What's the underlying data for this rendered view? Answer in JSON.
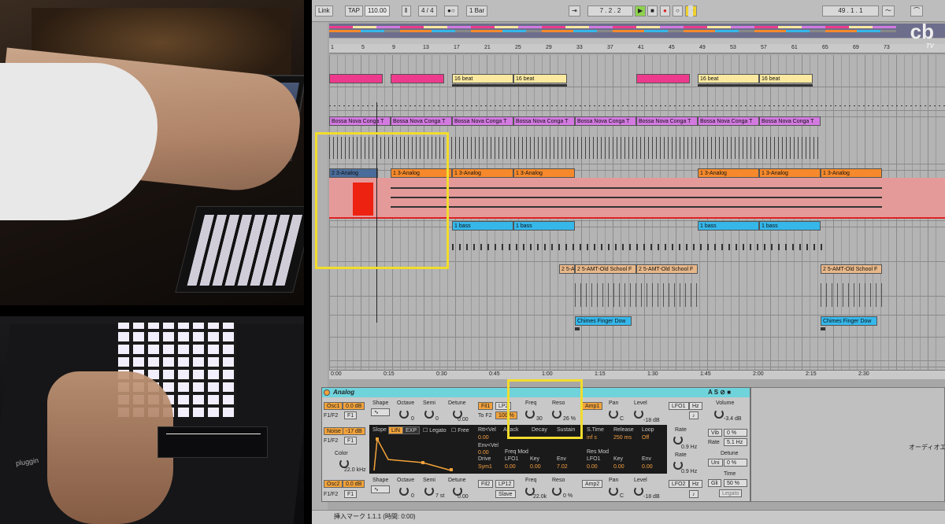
{
  "control_bar": {
    "link": "Link",
    "tap": "TAP",
    "tempo": "110.00",
    "signature": "4 / 4",
    "quantize": "1 Bar",
    "position": "7 . 2 . 2",
    "loop_position": "49 . 1 . 1"
  },
  "ruler": [
    "1",
    "5",
    "9",
    "13",
    "17",
    "21",
    "25",
    "29",
    "33",
    "37",
    "41",
    "45",
    "49",
    "53",
    "57",
    "61",
    "65",
    "69",
    "73"
  ],
  "timebar": [
    "0:00",
    "0:15",
    "0:30",
    "0:45",
    "1:00",
    "1:15",
    "1:30",
    "1:45",
    "2:00",
    "2:15",
    "2:30"
  ],
  "clips": {
    "beat1": "16 beat",
    "beat2": "16 beat",
    "beat3": "16 beat",
    "beat4": "16 beat",
    "bossa": "Bossa Nova Conga T",
    "analog_sel": "2 3-Analog",
    "analog": "1 3-Analog",
    "bass": "1 bass",
    "amt_short": "2 5-A",
    "amt": "2 5-AMT-Old School F",
    "chimes": "Chimes Finger Dow"
  },
  "device": {
    "title": "Analog",
    "osc1": "Osc1",
    "osc1_level": "0.0 dB",
    "f1f2": "F1/F2",
    "f1": "F1",
    "noise": "Noise",
    "noise_level": "-17 dB",
    "color_label": "Color",
    "color_value": "22.0 kHz",
    "osc2": "Osc2",
    "osc2_level": "0.0 dB",
    "shape": "Shape",
    "octave": "Octave",
    "semi": "Semi",
    "detune": "Detune",
    "octave_val": "0",
    "semi_val": "0",
    "detune_val": "0.00",
    "osc2_semi_val": "7 st",
    "fil1": "Fil1",
    "fil1_type": "LP2",
    "to_f2": "To F2",
    "to_f2_val": "100 %",
    "freq": "Freq",
    "freq_val": "30",
    "reso": "Reso",
    "reso_val": "26 %",
    "amp1": "Amp1",
    "pan": "Pan",
    "pan_val": "C",
    "level": "Level",
    "level_val": "-18 dB",
    "lfo1": "LFO1",
    "hz": "Hz",
    "rate": "Rate",
    "rate_val": "0.9 Hz",
    "volume": "Volume",
    "volume_val": "-3.4 dB",
    "vib": "Vib",
    "vib_val": "0 %",
    "rate2_val": "5.1 Hz",
    "unison": "Uni",
    "unison_val": "0 %",
    "detune_global": "Detune",
    "time": "Time",
    "gli": "Gli",
    "gli_val": "50 %",
    "legato": "Legato",
    "fil2": "Fil2",
    "fil2_type": "LP12",
    "slave": "Slave",
    "fil2_freq_val": "22.0k",
    "fil2_reso_val": "0 %",
    "amp2": "Amp2",
    "amp2_pan": "C",
    "amp2_level": "-18 dB",
    "lfo2": "LFO2"
  },
  "envelope": {
    "slope": "Slope",
    "lin": "LIN",
    "exp": "EXP",
    "legato": "Legato",
    "free": "Free",
    "attack": "Attack",
    "decay": "Decay",
    "sustain": "Sustain",
    "stime": "S.Time",
    "release": "Release",
    "loop": "Loop",
    "a_vel": "Rtt<Vel",
    "a_val": "0.00",
    "env_vel": "Env<Vel",
    "env_vel_val": "0.00",
    "stime_val": "inf s",
    "release_val": "250 ms",
    "loop_val": "Off",
    "drive": "Drive",
    "lfo1": "LFO1",
    "key": "Key",
    "env": "Env",
    "freq_mod": "Freq Mod",
    "res_mod": "Res Mod",
    "drive_val": "Sym1",
    "lfo_val": "0.00",
    "key_val": "0.00",
    "env_val": "7.02",
    "res_lfo": "LFO1",
    "res_key": "Key",
    "res_env": "Env",
    "res_lfo_val": "0.00",
    "res_key_val": "0.00",
    "res_env_val": "0.00"
  },
  "right_pane": {
    "text": "オーディオエフ"
  },
  "status": "挿入マーク 1.1.1 (時間: 0:00)",
  "logo": {
    "main": "cb",
    "sub": "TV"
  },
  "colors": {
    "pink": "#ee3a8c",
    "yellow": "#fbe9a0",
    "magenta": "#d27ae0",
    "blue": "#4a6c9a",
    "orange": "#f5892b",
    "cyan": "#35b7ea",
    "tan": "#e8b88a",
    "highlight": "#f2dc2c"
  }
}
